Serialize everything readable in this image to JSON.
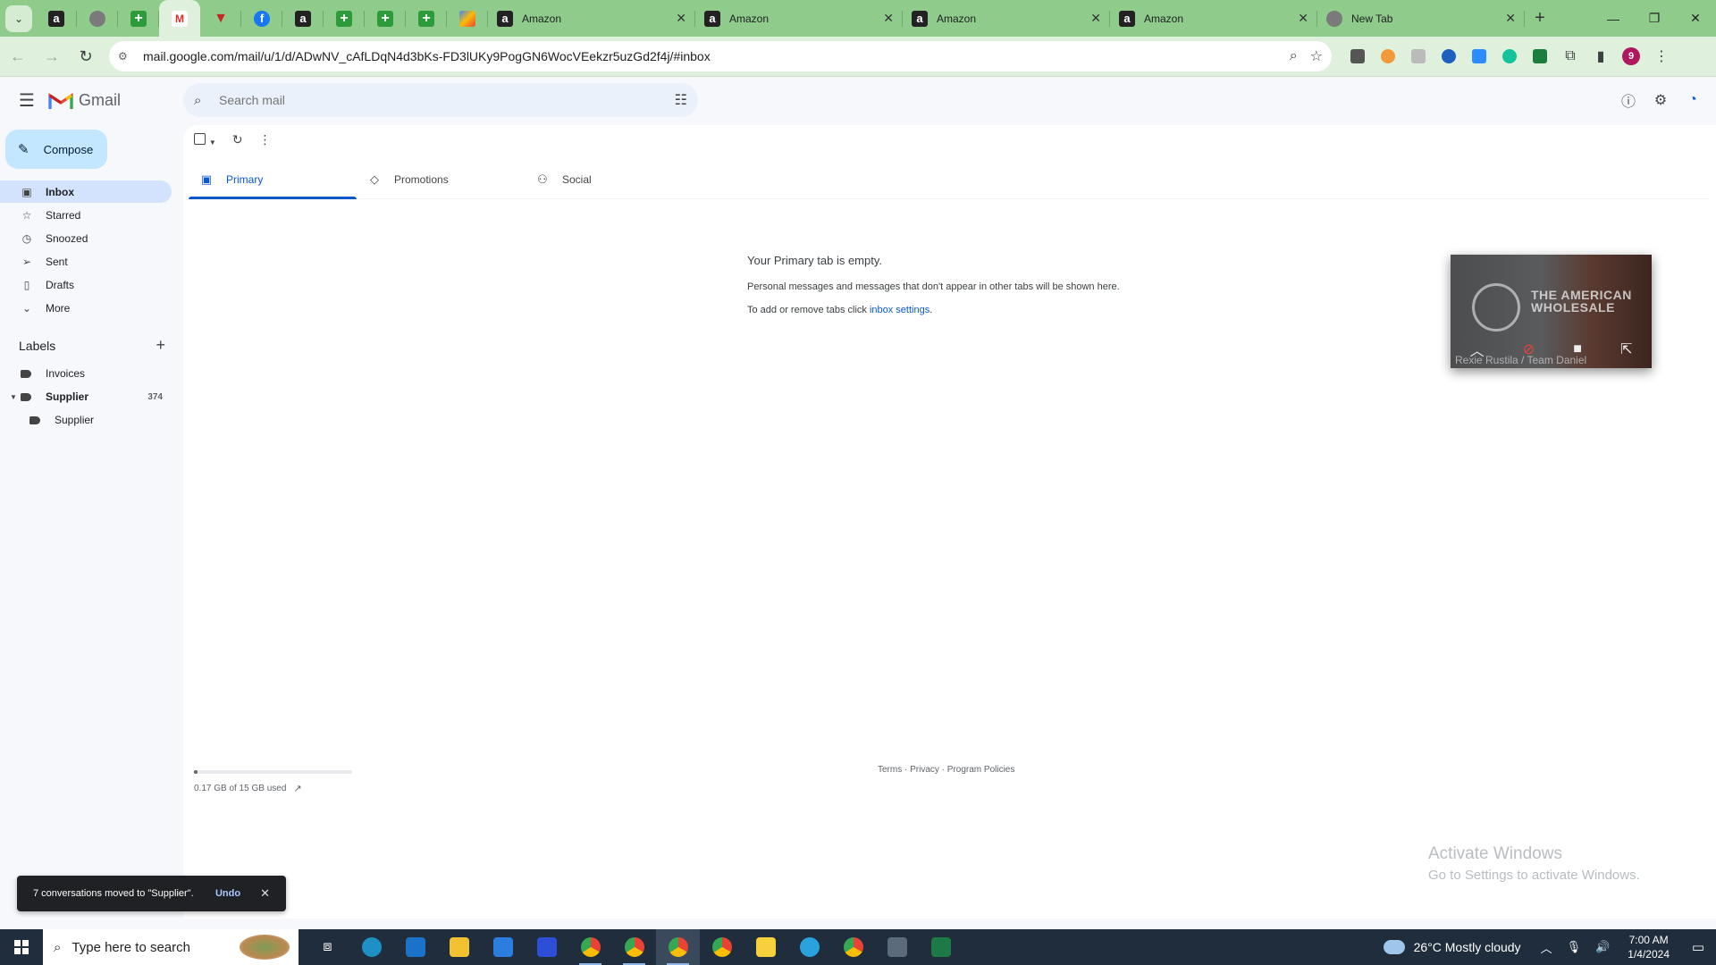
{
  "browser": {
    "tabs": [
      {
        "title": "Amazon"
      },
      {
        "title": "Amazon"
      },
      {
        "title": "Amazon"
      },
      {
        "title": "Amazon"
      },
      {
        "title": "New Tab"
      }
    ],
    "url": "mail.google.com/mail/u/1/d/ADwNV_cAfLDqN4d3bKs-FD3lUKy9PogGN6WocVEekzr5uzGd2f4j/#inbox",
    "profile_initial": "9"
  },
  "gmail": {
    "logo_text": "Gmail",
    "search_placeholder": "Search mail",
    "compose_label": "Compose",
    "nav": [
      {
        "label": "Inbox",
        "icon": "inbox-icon"
      },
      {
        "label": "Starred",
        "icon": "star-icon"
      },
      {
        "label": "Snoozed",
        "icon": "clock-icon"
      },
      {
        "label": "Sent",
        "icon": "send-icon"
      },
      {
        "label": "Drafts",
        "icon": "draft-icon"
      },
      {
        "label": "More",
        "icon": "chevron-down-icon"
      }
    ],
    "labels_heading": "Labels",
    "labels": [
      {
        "name": "Invoices",
        "count": ""
      },
      {
        "name": "Supplier",
        "count": "374"
      },
      {
        "name": "Supplier",
        "count": ""
      }
    ],
    "tabs": [
      {
        "label": "Primary"
      },
      {
        "label": "Promotions"
      },
      {
        "label": "Social"
      }
    ],
    "empty": {
      "heading": "Your Primary tab is empty.",
      "line1": "Personal messages and messages that don't appear in other tabs will be shown here.",
      "line2_prefix": "To add or remove tabs click ",
      "line2_link": "inbox settings",
      "line2_suffix": "."
    },
    "storage": {
      "text": "0.17 GB of 15 GB used",
      "used_fraction": 0.011
    },
    "footer": "Terms · Privacy · Program Policies",
    "snackbar": {
      "message": "7 conversations moved to \"Supplier\".",
      "undo": "Undo"
    }
  },
  "video_pip": {
    "brand": "THE AMERICAN WHOLESALE",
    "caption": "Rexie Rustila / Team Daniel"
  },
  "watermark": {
    "title": "Activate Windows",
    "subtitle": "Go to Settings to activate Windows."
  },
  "taskbar": {
    "search_placeholder": "Type here to search",
    "weather": "26°C  Mostly cloudy",
    "time": "7:00 AM",
    "date": "1/4/2024"
  },
  "colors": {
    "chrome_frame": "#8fcb8a",
    "compose_bg": "#c2e7ff",
    "active_nav": "#d3e3fd",
    "accent": "#0b57d0",
    "taskbar": "#1f2d3d"
  }
}
